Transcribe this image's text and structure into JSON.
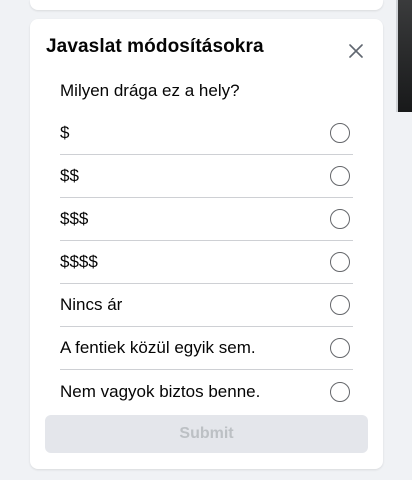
{
  "dialog": {
    "title": "Javaslat módosításokra",
    "close_icon": "close-icon",
    "question": "Milyen drága ez a hely?",
    "options": [
      {
        "label": "$",
        "selected": false
      },
      {
        "label": "$$",
        "selected": false
      },
      {
        "label": "$$$",
        "selected": false
      },
      {
        "label": "$$$$",
        "selected": false
      },
      {
        "label": "Nincs ár",
        "selected": false
      },
      {
        "label": "A fentiek közül egyik sem.",
        "selected": false
      },
      {
        "label": "Nem vagyok biztos benne.",
        "selected": false
      }
    ],
    "submit_label": "Submit",
    "submit_enabled": false
  },
  "colors": {
    "background": "#f0f2f5",
    "card": "#ffffff",
    "divider": "#ced0d4",
    "disabled_button_bg": "#e4e6eb",
    "disabled_button_text": "#bcc0c4"
  }
}
